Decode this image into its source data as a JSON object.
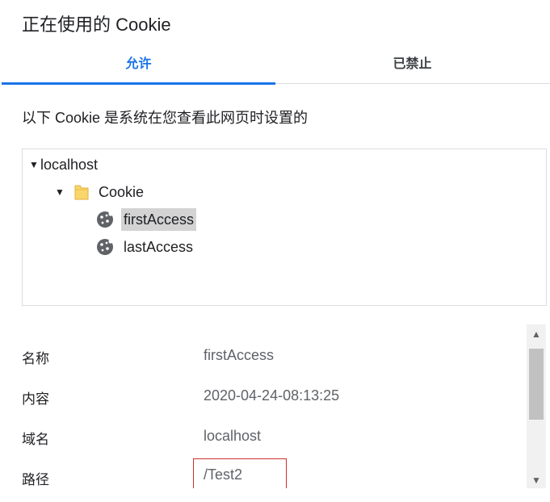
{
  "dialog": {
    "title": "正在使用的 Cookie"
  },
  "tabs": [
    {
      "label": "允许",
      "active": true
    },
    {
      "label": "已禁止",
      "active": false
    }
  ],
  "description": "以下 Cookie 是系统在您查看此网页时设置的",
  "tree": {
    "site": {
      "label": "localhost",
      "icon": "triangle-down-icon"
    },
    "folder": {
      "label": "Cookie",
      "icon": "folder-icon"
    },
    "cookies": [
      {
        "label": "firstAccess",
        "selected": true,
        "icon": "cookie-icon"
      },
      {
        "label": "lastAccess",
        "selected": false,
        "icon": "cookie-icon"
      }
    ]
  },
  "details": [
    {
      "label": "名称",
      "value": "firstAccess"
    },
    {
      "label": "内容",
      "value": "2020-04-24-08:13:25"
    },
    {
      "label": "域名",
      "value": "localhost"
    },
    {
      "label": "路径",
      "value": "/Test2"
    }
  ],
  "colors": {
    "accent": "#1a73e8",
    "highlight_box": "#c9302c",
    "folder": "#f9d66b",
    "selection": "#d3d3d3"
  }
}
